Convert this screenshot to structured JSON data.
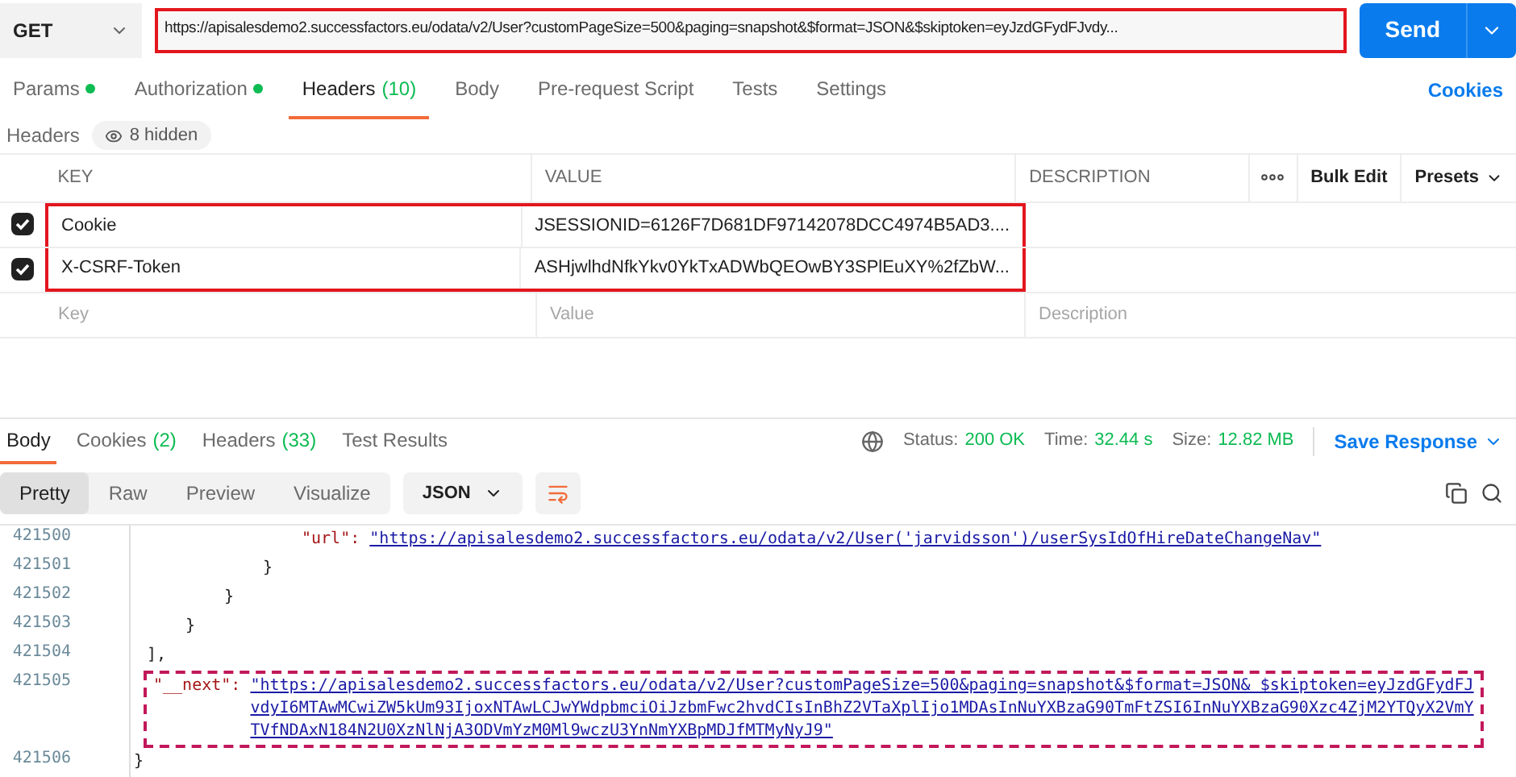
{
  "request": {
    "method": "GET",
    "url": "https://apisalesdemo2.successfactors.eu/odata/v2/User?customPageSize=500&paging=snapshot&$format=JSON&$skiptoken=eyJzdGFydFJvdy...",
    "highlighted": true,
    "send": "Send"
  },
  "tabs": [
    {
      "label": "Params",
      "dot": true,
      "selected": false
    },
    {
      "label": "Authorization",
      "dot": true,
      "selected": false
    },
    {
      "label": "Headers",
      "count": "(10)",
      "dot": false,
      "selected": true
    },
    {
      "label": "Body",
      "dot": false,
      "selected": false
    },
    {
      "label": "Pre-request Script",
      "dot": false,
      "selected": false
    },
    {
      "label": "Tests",
      "dot": false,
      "selected": false
    },
    {
      "label": "Settings",
      "dot": false,
      "selected": false
    }
  ],
  "cookies_link": "Cookies",
  "headers_bar": {
    "title": "Headers",
    "hidden": "8 hidden"
  },
  "table": {
    "columns": [
      "KEY",
      "VALUE",
      "DESCRIPTION"
    ],
    "bulk_edit": "Bulk Edit",
    "presets": "Presets",
    "rows": [
      {
        "checked": true,
        "key": "Cookie",
        "value": "JSESSIONID=6126F7D681DF97142078DCC4974B5AD3....",
        "highlighted": true
      },
      {
        "checked": true,
        "key": "X-CSRF-Token",
        "value": "ASHjwlhdNfkYkv0YkTxADWbQEOwBY3SPlEuXY%2fZbW...",
        "highlighted": true
      }
    ],
    "placeholder": {
      "key": "Key",
      "value": "Value",
      "description": "Description"
    }
  },
  "response": {
    "tabs": [
      {
        "label": "Body",
        "selected": true
      },
      {
        "label": "Cookies",
        "count": "(2)",
        "selected": false
      },
      {
        "label": "Headers",
        "count": "(33)",
        "selected": false
      },
      {
        "label": "Test Results",
        "selected": false
      }
    ],
    "status_label": "Status:",
    "status": "200 OK",
    "time_label": "Time:",
    "time": "32.44 s",
    "size_label": "Size:",
    "size": "12.82 MB",
    "save": "Save Response",
    "views": [
      {
        "label": "Pretty",
        "selected": true
      },
      {
        "label": "Raw",
        "selected": false
      },
      {
        "label": "Preview",
        "selected": false
      },
      {
        "label": "Visualize",
        "selected": false
      }
    ],
    "format": "JSON",
    "lines": [
      {
        "number": "421500",
        "key": "\"url\"",
        "sep": ": ",
        "link": "\"https://apisalesdemo2.successfactors.eu/odata/v2/User('jarvidsson')/userSysIdOfHireDateChangeNav\"",
        "highlighted": false
      },
      {
        "number": "421501",
        "punct": "}",
        "highlighted": false
      },
      {
        "number": "421502",
        "punct": "}",
        "highlighted": false
      },
      {
        "number": "421503",
        "punct": "}",
        "highlighted": false
      },
      {
        "number": "421504",
        "punct": "],",
        "highlighted": false
      },
      {
        "number": "421505",
        "key": "\"__next\"",
        "sep": ": ",
        "link": "\"https://apisalesdemo2.successfactors.eu/odata/v2/User?customPageSize=500&paging=snapshot&$format=JSON& $skiptoken=eyJzdGFydFJvdyI6MTAwMCwiZW5kUm93IjoxNTAwLCJwYWdpbmciOiJzbmFwc2hvdCIsInBhZ2VTaXplIjo1MDAsInNuYXBzaG90TmFtZSI6InNuYXBzaG90Xzc4ZjM2YTQyX2VmYTVfNDAxN184N2U0XzNlNjA3ODVmYzM0Ml9wczU3YnNmYXBpMDJfMTMyNyJ9\"",
        "highlighted": true
      },
      {
        "number": "421506",
        "punct": "}",
        "highlighted": false
      }
    ]
  }
}
